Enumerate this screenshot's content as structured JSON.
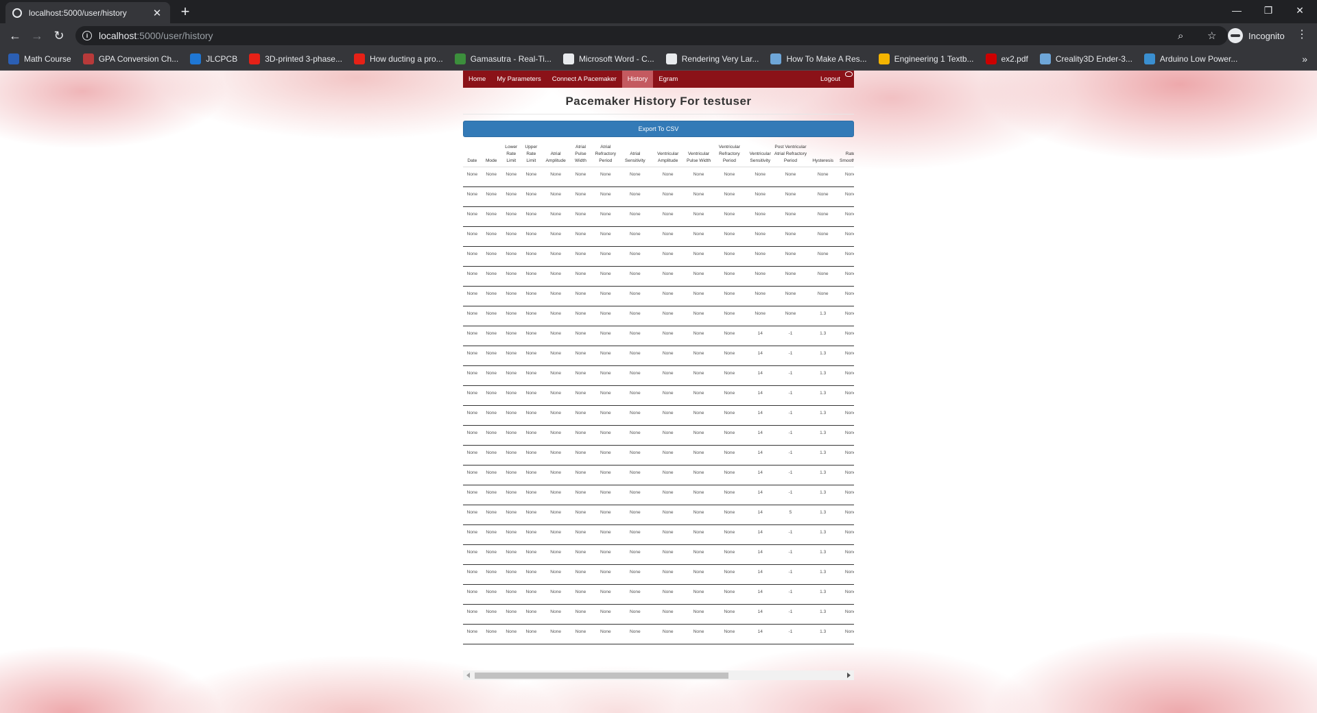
{
  "browser": {
    "tab_title": "localhost:5000/user/history",
    "url_host": "localhost",
    "url_path": ":5000/user/history",
    "profile_label": "Incognito",
    "bookmarks": [
      {
        "label": "Math Course",
        "icon": "sigma-icon",
        "color": "#2b5fb4"
      },
      {
        "label": "GPA Conversion Ch...",
        "icon": "gpa-icon",
        "color": "#b83a3a"
      },
      {
        "label": "JLCPCB",
        "icon": "jlc-icon",
        "color": "#1f77d4"
      },
      {
        "label": "3D-printed 3-phase...",
        "icon": "youtube-icon",
        "color": "#e62117"
      },
      {
        "label": "How ducting a pro...",
        "icon": "youtube-icon",
        "color": "#e62117"
      },
      {
        "label": "Gamasutra - Real-Ti...",
        "icon": "gamasutra-icon",
        "color": "#3c8f3c"
      },
      {
        "label": "Microsoft Word - C...",
        "icon": "globe-icon",
        "color": "#e8eaed"
      },
      {
        "label": "Rendering Very Lar...",
        "icon": "globe-icon",
        "color": "#e8eaed"
      },
      {
        "label": "How To Make A Res...",
        "icon": "image-icon",
        "color": "#6ea6d8"
      },
      {
        "label": "Engineering 1 Textb...",
        "icon": "drive-icon",
        "color": "#f4b400"
      },
      {
        "label": "ex2.pdf",
        "icon": "pdf-icon",
        "color": "#cc0000"
      },
      {
        "label": "Creality3D Ender-3...",
        "icon": "image-icon",
        "color": "#6ea6d8"
      },
      {
        "label": "Arduino Low Power...",
        "icon": "hc-icon",
        "color": "#3a8fd0"
      }
    ]
  },
  "navbar": {
    "items": [
      {
        "label": "Home",
        "active": false
      },
      {
        "label": "My Parameters",
        "active": false
      },
      {
        "label": "Connect A Pacemaker",
        "active": false
      },
      {
        "label": "History",
        "active": true
      },
      {
        "label": "Egram",
        "active": false
      }
    ],
    "logout_label": "Logout",
    "brand_color": "#8b1218",
    "active_color": "#c45a60"
  },
  "page": {
    "title": "Pacemaker History For testuser",
    "export_label": "Export To CSV"
  },
  "table": {
    "headers": [
      "Date",
      "Mode",
      "Lower Rate Limit",
      "Upper Rate Limit",
      "Atrial Amplitude",
      "Atrial Pulse Width",
      "Atrial Refractory Period",
      "Atrial Sensitivity",
      "Ventricular Amplitude",
      "Ventricular Pulse Width",
      "Ventricular Refractory Period",
      "Ventricular Sensitivity",
      "Post Ventricular Atrial Refractory Period",
      "Hysteresis",
      "Rate Smoothing"
    ],
    "rows": [
      [
        "None",
        "None",
        "None",
        "None",
        "None",
        "None",
        "None",
        "None",
        "None",
        "None",
        "None",
        "None",
        "None",
        "None",
        "None"
      ],
      [
        "None",
        "None",
        "None",
        "None",
        "None",
        "None",
        "None",
        "None",
        "None",
        "None",
        "None",
        "None",
        "None",
        "None",
        "None"
      ],
      [
        "None",
        "None",
        "None",
        "None",
        "None",
        "None",
        "None",
        "None",
        "None",
        "None",
        "None",
        "None",
        "None",
        "None",
        "None"
      ],
      [
        "None",
        "None",
        "None",
        "None",
        "None",
        "None",
        "None",
        "None",
        "None",
        "None",
        "None",
        "None",
        "None",
        "None",
        "None"
      ],
      [
        "None",
        "None",
        "None",
        "None",
        "None",
        "None",
        "None",
        "None",
        "None",
        "None",
        "None",
        "None",
        "None",
        "None",
        "None"
      ],
      [
        "None",
        "None",
        "None",
        "None",
        "None",
        "None",
        "None",
        "None",
        "None",
        "None",
        "None",
        "None",
        "None",
        "None",
        "None"
      ],
      [
        "None",
        "None",
        "None",
        "None",
        "None",
        "None",
        "None",
        "None",
        "None",
        "None",
        "None",
        "None",
        "None",
        "None",
        "None"
      ],
      [
        "None",
        "None",
        "None",
        "None",
        "None",
        "None",
        "None",
        "None",
        "None",
        "None",
        "None",
        "None",
        "None",
        "1.3",
        "None"
      ],
      [
        "None",
        "None",
        "None",
        "None",
        "None",
        "None",
        "None",
        "None",
        "None",
        "None",
        "None",
        "14",
        "-1",
        "1.3",
        "None"
      ],
      [
        "None",
        "None",
        "None",
        "None",
        "None",
        "None",
        "None",
        "None",
        "None",
        "None",
        "None",
        "14",
        "-1",
        "1.3",
        "None"
      ],
      [
        "None",
        "None",
        "None",
        "None",
        "None",
        "None",
        "None",
        "None",
        "None",
        "None",
        "None",
        "14",
        "-1",
        "1.3",
        "None"
      ],
      [
        "None",
        "None",
        "None",
        "None",
        "None",
        "None",
        "None",
        "None",
        "None",
        "None",
        "None",
        "14",
        "-1",
        "1.3",
        "None"
      ],
      [
        "None",
        "None",
        "None",
        "None",
        "None",
        "None",
        "None",
        "None",
        "None",
        "None",
        "None",
        "14",
        "-1",
        "1.3",
        "None"
      ],
      [
        "None",
        "None",
        "None",
        "None",
        "None",
        "None",
        "None",
        "None",
        "None",
        "None",
        "None",
        "14",
        "-1",
        "1.3",
        "None"
      ],
      [
        "None",
        "None",
        "None",
        "None",
        "None",
        "None",
        "None",
        "None",
        "None",
        "None",
        "None",
        "14",
        "-1",
        "1.3",
        "None"
      ],
      [
        "None",
        "None",
        "None",
        "None",
        "None",
        "None",
        "None",
        "None",
        "None",
        "None",
        "None",
        "14",
        "-1",
        "1.3",
        "None"
      ],
      [
        "None",
        "None",
        "None",
        "None",
        "None",
        "None",
        "None",
        "None",
        "None",
        "None",
        "None",
        "14",
        "-1",
        "1.3",
        "None"
      ],
      [
        "None",
        "None",
        "None",
        "None",
        "None",
        "None",
        "None",
        "None",
        "None",
        "None",
        "None",
        "14",
        "5",
        "1.3",
        "None"
      ],
      [
        "None",
        "None",
        "None",
        "None",
        "None",
        "None",
        "None",
        "None",
        "None",
        "None",
        "None",
        "14",
        "-1",
        "1.3",
        "None"
      ],
      [
        "None",
        "None",
        "None",
        "None",
        "None",
        "None",
        "None",
        "None",
        "None",
        "None",
        "None",
        "14",
        "-1",
        "1.3",
        "None"
      ],
      [
        "None",
        "None",
        "None",
        "None",
        "None",
        "None",
        "None",
        "None",
        "None",
        "None",
        "None",
        "14",
        "-1",
        "1.3",
        "None"
      ],
      [
        "None",
        "None",
        "None",
        "None",
        "None",
        "None",
        "None",
        "None",
        "None",
        "None",
        "None",
        "14",
        "-1",
        "1.3",
        "None"
      ],
      [
        "None",
        "None",
        "None",
        "None",
        "None",
        "None",
        "None",
        "None",
        "None",
        "None",
        "None",
        "14",
        "-1",
        "1.3",
        "None"
      ],
      [
        "None",
        "None",
        "None",
        "None",
        "None",
        "None",
        "None",
        "None",
        "None",
        "None",
        "None",
        "14",
        "-1",
        "1.3",
        "None"
      ]
    ]
  }
}
